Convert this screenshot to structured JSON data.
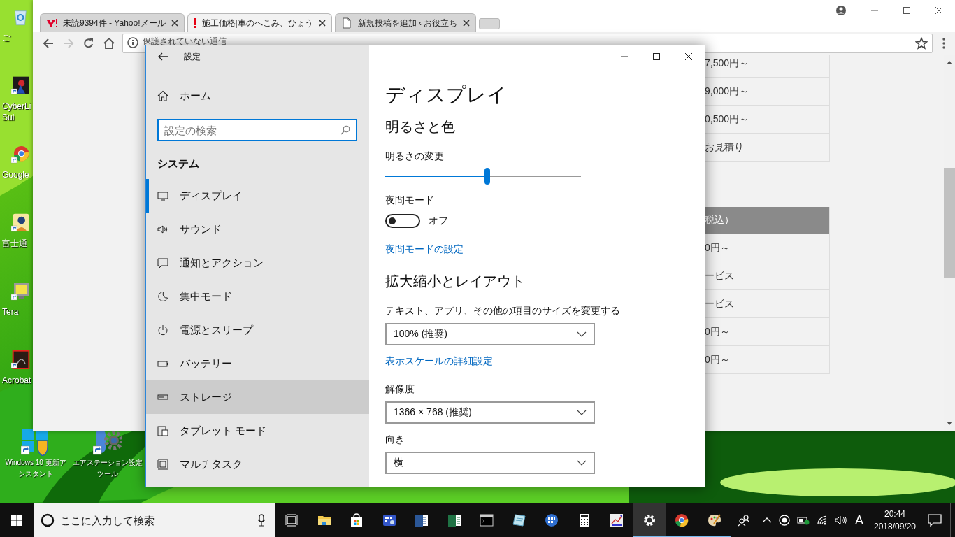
{
  "desktop": {
    "column_icons": [
      {
        "kind": "recycle",
        "lines": [
          "ご"
        ]
      },
      {
        "kind": "cyberlink",
        "lines": [
          "CyberLi",
          "Sui"
        ]
      },
      {
        "kind": "browser",
        "lines": [
          "Google"
        ]
      },
      {
        "kind": "fujitsu",
        "lines": [
          "富士通"
        ]
      },
      {
        "kind": "tera",
        "lines": [
          "Tera"
        ]
      },
      {
        "kind": "acrobat",
        "lines": [
          "Acrobat"
        ]
      }
    ],
    "bottom_icons": [
      {
        "kind": "windows-update",
        "lines": [
          "Windows 10 更新ア",
          "シスタント"
        ]
      },
      {
        "kind": "airstation",
        "lines": [
          "エアステーション設定",
          "ツール"
        ]
      }
    ]
  },
  "browser": {
    "tabs": [
      {
        "kind": "yahoo",
        "title": "未読9394件 - Yahoo!メール",
        "selected": false
      },
      {
        "kind": "exclaim",
        "title": "施工価格|車のへこみ、ひょう",
        "selected": true
      },
      {
        "kind": "page",
        "title": "新規投稿を追加 ‹ お役立ち",
        "selected": false
      }
    ],
    "address": "保護されていない通信",
    "table_rows": [
      {
        "kind": "cell",
        "text": "7,500円～"
      },
      {
        "kind": "cell",
        "text": "9,000円～"
      },
      {
        "kind": "cell",
        "text": "0,500円～"
      },
      {
        "kind": "cell",
        "text": "お見積り"
      },
      {
        "kind": "header",
        "text": "税込）"
      },
      {
        "kind": "cell",
        "text": "0円～"
      },
      {
        "kind": "cell",
        "text": "ービス"
      },
      {
        "kind": "cell",
        "text": "ービス"
      },
      {
        "kind": "cell",
        "text": "0円～"
      },
      {
        "kind": "cell",
        "text": "0円～"
      }
    ]
  },
  "settings": {
    "title": "設定",
    "home": "ホーム",
    "search_placeholder": "設定の検索",
    "section": "システム",
    "nav": [
      {
        "kind": "display",
        "label": "ディスプレイ",
        "selected": true,
        "hovered": false
      },
      {
        "kind": "sound",
        "label": "サウンド",
        "selected": false,
        "hovered": false
      },
      {
        "kind": "notify",
        "label": "通知とアクション",
        "selected": false,
        "hovered": false
      },
      {
        "kind": "focus",
        "label": "集中モード",
        "selected": false,
        "hovered": false
      },
      {
        "kind": "power",
        "label": "電源とスリープ",
        "selected": false,
        "hovered": false
      },
      {
        "kind": "battery",
        "label": "バッテリー",
        "selected": false,
        "hovered": false
      },
      {
        "kind": "storage",
        "label": "ストレージ",
        "selected": false,
        "hovered": true
      },
      {
        "kind": "tablet",
        "label": "タブレット モード",
        "selected": false,
        "hovered": false
      },
      {
        "kind": "multitask",
        "label": "マルチタスク",
        "selected": false,
        "hovered": false
      }
    ],
    "page": {
      "title": "ディスプレイ",
      "items": [
        {
          "kind": "heading",
          "text": "明るさと色"
        },
        {
          "kind": "label",
          "text": "明るさの変更"
        },
        {
          "kind": "slider",
          "level": 0.52
        },
        {
          "kind": "label",
          "text": "夜間モード"
        },
        {
          "kind": "toggle",
          "on": false,
          "text": "オフ"
        },
        {
          "kind": "link",
          "text": "夜間モードの設定"
        },
        {
          "kind": "heading",
          "text": "拡大縮小とレイアウト"
        },
        {
          "kind": "label",
          "text": "テキスト、アプリ、その他の項目のサイズを変更する"
        },
        {
          "kind": "dropdown",
          "value": "100% (推奨)"
        },
        {
          "kind": "link",
          "text": "表示スケールの詳細設定"
        },
        {
          "kind": "label",
          "text": "解像度"
        },
        {
          "kind": "dropdown",
          "value": "1366 × 768 (推奨)"
        },
        {
          "kind": "label",
          "text": "向き"
        },
        {
          "kind": "dropdown",
          "value": "横"
        }
      ]
    }
  },
  "taskbar": {
    "search_placeholder": "ここに入力して検索",
    "apps": [
      {
        "kind": "taskview",
        "running": false,
        "active": false
      },
      {
        "kind": "folder",
        "running": false,
        "active": false
      },
      {
        "kind": "store",
        "running": false,
        "active": false
      },
      {
        "kind": "appgrid",
        "running": false,
        "active": false
      },
      {
        "kind": "word",
        "running": false,
        "active": false
      },
      {
        "kind": "excel",
        "running": false,
        "active": false
      },
      {
        "kind": "terminal",
        "running": false,
        "active": false
      },
      {
        "kind": "notepad",
        "running": false,
        "active": false
      },
      {
        "kind": "globe",
        "running": false,
        "active": false
      },
      {
        "kind": "calculator",
        "running": false,
        "active": false
      },
      {
        "kind": "chart",
        "running": false,
        "active": false
      },
      {
        "kind": "gear",
        "running": true,
        "active": true
      },
      {
        "kind": "browser",
        "running": true,
        "active": false
      },
      {
        "kind": "paint",
        "running": true,
        "active": false
      }
    ],
    "ime": "A",
    "time": "20:44",
    "date": "2018/09/20"
  }
}
